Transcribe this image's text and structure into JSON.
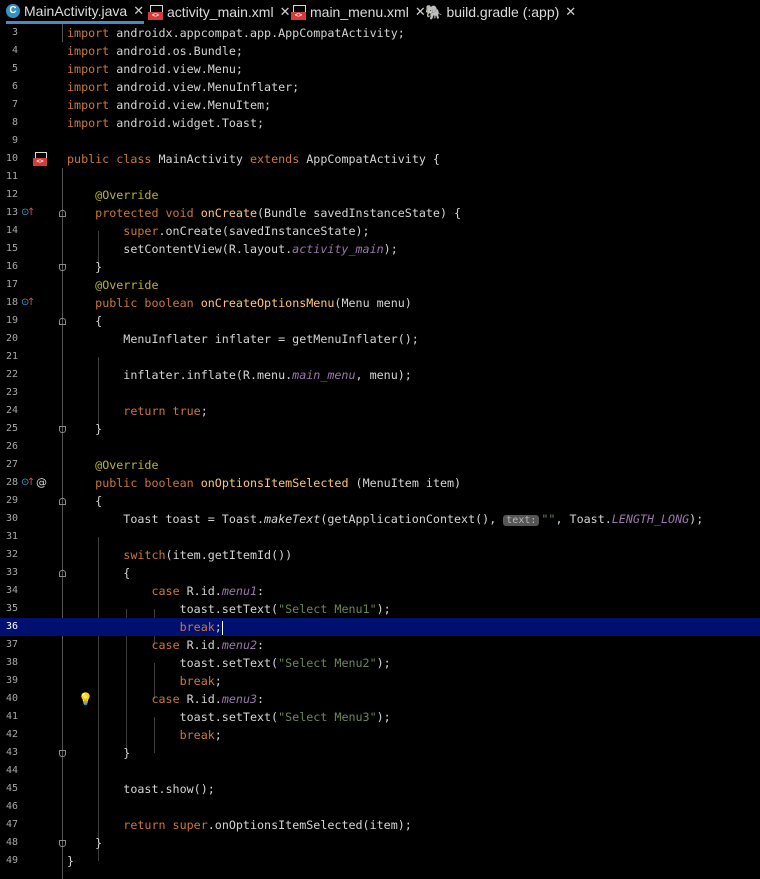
{
  "tabs": [
    {
      "label": "MainActivity.java",
      "icon": "java-class-icon",
      "active": true
    },
    {
      "label": "activity_main.xml",
      "icon": "xml-file-icon",
      "active": false
    },
    {
      "label": "main_menu.xml",
      "icon": "xml-file-icon",
      "active": false
    },
    {
      "label": "build.gradle (:app)",
      "icon": "gradle-icon",
      "active": false
    }
  ],
  "tab_close_glyph": "✕",
  "editor": {
    "caret_line": 36,
    "inlay_hint": "text:",
    "lines": [
      {
        "n": "3",
        "text": "import androidx.appcompat.app.AppCompatActivity;"
      },
      {
        "n": "4",
        "text": "import android.os.Bundle;"
      },
      {
        "n": "5",
        "text": "import android.view.Menu;"
      },
      {
        "n": "6",
        "text": "import android.view.MenuInflater;"
      },
      {
        "n": "7",
        "text": "import android.view.MenuItem;"
      },
      {
        "n": "8",
        "text": "import android.widget.Toast;"
      },
      {
        "n": "9",
        "text": ""
      },
      {
        "n": "10",
        "text": "public class MainActivity extends AppCompatActivity {"
      },
      {
        "n": "11",
        "text": ""
      },
      {
        "n": "12",
        "text": "    @Override"
      },
      {
        "n": "13",
        "text": "    protected void onCreate(Bundle savedInstanceState) {"
      },
      {
        "n": "14",
        "text": "        super.onCreate(savedInstanceState);"
      },
      {
        "n": "15",
        "text": "        setContentView(R.layout.activity_main);"
      },
      {
        "n": "16",
        "text": "    }"
      },
      {
        "n": "17",
        "text": "    @Override"
      },
      {
        "n": "18",
        "text": "    public boolean onCreateOptionsMenu(Menu menu)"
      },
      {
        "n": "19",
        "text": "    {"
      },
      {
        "n": "20",
        "text": "        MenuInflater inflater = getMenuInflater();"
      },
      {
        "n": "21",
        "text": ""
      },
      {
        "n": "22",
        "text": "        inflater.inflate(R.menu.main_menu, menu);"
      },
      {
        "n": "23",
        "text": ""
      },
      {
        "n": "24",
        "text": "        return true;"
      },
      {
        "n": "25",
        "text": "    }"
      },
      {
        "n": "26",
        "text": ""
      },
      {
        "n": "27",
        "text": "    @Override"
      },
      {
        "n": "28",
        "text": "    public boolean onOptionsItemSelected (MenuItem item)"
      },
      {
        "n": "29",
        "text": "    {"
      },
      {
        "n": "30",
        "text": "        Toast toast = Toast.makeText(getApplicationContext(), \"\", Toast.LENGTH_LONG);"
      },
      {
        "n": "31",
        "text": ""
      },
      {
        "n": "32",
        "text": "        switch(item.getItemId())"
      },
      {
        "n": "33",
        "text": "        {"
      },
      {
        "n": "34",
        "text": "            case R.id.menu1:"
      },
      {
        "n": "35",
        "text": "                toast.setText(\"Select Menu1\");"
      },
      {
        "n": "36",
        "text": "                break;"
      },
      {
        "n": "37",
        "text": "            case R.id.menu2:"
      },
      {
        "n": "38",
        "text": "                toast.setText(\"Select Menu2\");"
      },
      {
        "n": "39",
        "text": "                break;"
      },
      {
        "n": "40",
        "text": "            case R.id.menu3:"
      },
      {
        "n": "41",
        "text": "                toast.setText(\"Select Menu3\");"
      },
      {
        "n": "42",
        "text": "                break;"
      },
      {
        "n": "43",
        "text": "        }"
      },
      {
        "n": "44",
        "text": ""
      },
      {
        "n": "45",
        "text": "        toast.show();"
      },
      {
        "n": "46",
        "text": ""
      },
      {
        "n": "47",
        "text": "        return super.onOptionsItemSelected(item);"
      },
      {
        "n": "48",
        "text": "    }"
      },
      {
        "n": "49",
        "text": "}"
      }
    ]
  },
  "gutter_icons": [
    {
      "line": "10",
      "icons": [
        "xml-layout-badge-icon"
      ]
    },
    {
      "line": "13",
      "icons": [
        "override-icon",
        "implemented-up-arrow-icon"
      ]
    },
    {
      "line": "18",
      "icons": [
        "override-icon",
        "implemented-up-arrow-icon"
      ]
    },
    {
      "line": "28",
      "icons": [
        "override-icon",
        "implemented-up-arrow-icon",
        "annotation-at-icon"
      ]
    },
    {
      "line": "40",
      "icons": [
        "lightbulb-icon"
      ]
    }
  ],
  "colors": {
    "background": "#000000",
    "keyword": "#cc7832",
    "annotation": "#bbb529",
    "string": "#6a8759",
    "method_decl": "#ffc66d",
    "field": "#9876aa",
    "caret_row": "#001070",
    "active_tab_underline": "#4a88c7"
  }
}
